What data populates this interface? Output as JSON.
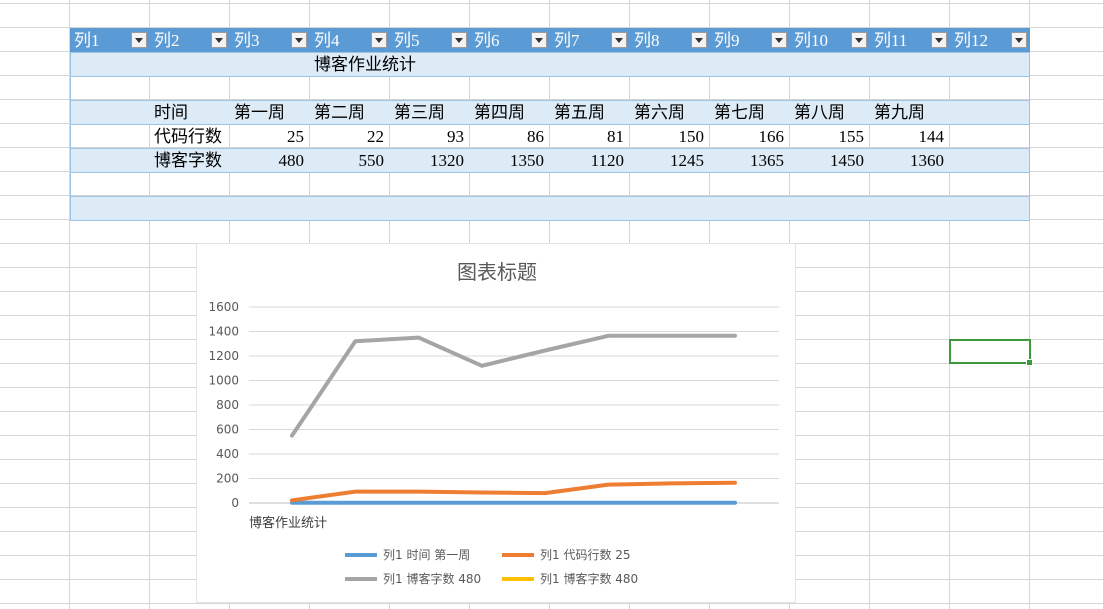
{
  "table": {
    "headers": [
      "列1",
      "列2",
      "列3",
      "列4",
      "列5",
      "列6",
      "列7",
      "列8",
      "列9",
      "列10",
      "列11",
      "列12"
    ],
    "title_row": "博客作业统计",
    "week_row": [
      "时间",
      "第一周",
      "第二周",
      "第三周",
      "第四周",
      "第五周",
      "第六周",
      "第七周",
      "第八周",
      "第九周"
    ],
    "code_row": {
      "label": "代码行数",
      "values": [
        25,
        22,
        93,
        86,
        81,
        150,
        166,
        155,
        144
      ]
    },
    "words_row": {
      "label": "博客字数",
      "values": [
        480,
        550,
        1320,
        1350,
        1120,
        1245,
        1365,
        1450,
        1360
      ]
    },
    "header_color": "#5b9bd5",
    "band_color": "#ddebf7"
  },
  "chart": {
    "title": "图表标题",
    "category_label": "博客作业统计",
    "legend": [
      {
        "label": "列1 时间 第一周",
        "color": "#5b9bd5"
      },
      {
        "label": "列1 代码行数 25",
        "color": "#ed7d31"
      },
      {
        "label": "列1 博客字数 480",
        "color": "#a5a5a5"
      },
      {
        "label": "列1 博客字数 480",
        "color": "#ffc000"
      }
    ]
  },
  "chart_data": {
    "type": "line",
    "title": "图表标题",
    "ylim": [
      0,
      1600
    ],
    "yticks": [
      0,
      200,
      400,
      600,
      800,
      1000,
      1200,
      1400,
      1600
    ],
    "grid": true,
    "legend_position": "bottom",
    "x_tick_label": "博客作业统计",
    "series": [
      {
        "name": "列1 时间 第一周",
        "color": "#5b9bd5",
        "values": [
          2,
          2,
          2,
          2,
          2,
          2,
          2,
          2
        ]
      },
      {
        "name": "列1 代码行数 25",
        "color": "#ed7d31",
        "values": [
          22,
          93,
          93,
          86,
          81,
          150,
          160,
          166
        ]
      },
      {
        "name": "列1 博客字数 480",
        "color": "#a5a5a5",
        "values": [
          550,
          1320,
          1350,
          1120,
          1245,
          1365,
          1365,
          1365
        ]
      },
      {
        "name": "列1 博客字数 480",
        "color": "#ffc000",
        "values": []
      }
    ]
  }
}
